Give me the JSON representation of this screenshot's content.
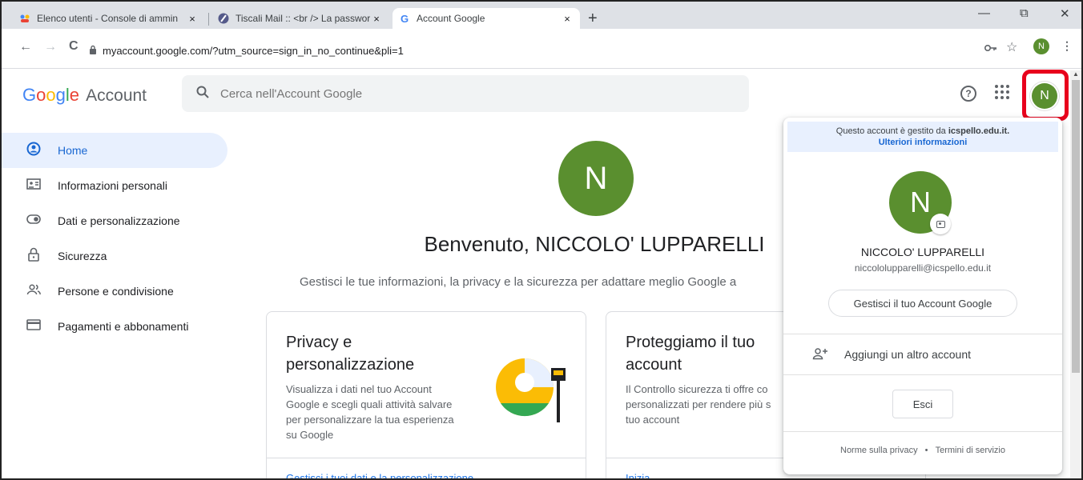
{
  "browser": {
    "tabs": [
      {
        "title": "Elenco utenti - Console di ammin",
        "icon": "admin-console-icon"
      },
      {
        "title": "Tiscali Mail :: <br /> La password",
        "icon": "tiscali-icon"
      },
      {
        "title": "Account Google",
        "icon": "google-g-icon"
      }
    ],
    "close_glyph": "×",
    "new_tab_glyph": "+",
    "url": "myaccount.google.com/?utm_source=sign_in_no_continue&pli=1",
    "profile_initial": "N"
  },
  "header": {
    "logo_letters": [
      "G",
      "o",
      "o",
      "g",
      "l",
      "e"
    ],
    "logo_suffix": "Account",
    "search_placeholder": "Cerca nell'Account Google",
    "help_glyph": "?",
    "avatar_initial": "N"
  },
  "sidebar": {
    "items": [
      {
        "label": "Home",
        "icon": "home-icon",
        "active": true
      },
      {
        "label": "Informazioni personali",
        "icon": "id-card-icon",
        "active": false
      },
      {
        "label": "Dati e personalizzazione",
        "icon": "toggle-icon",
        "active": false
      },
      {
        "label": "Sicurezza",
        "icon": "lock-icon",
        "active": false
      },
      {
        "label": "Persone e condivisione",
        "icon": "people-icon",
        "active": false
      },
      {
        "label": "Pagamenti e abbonamenti",
        "icon": "credit-card-icon",
        "active": false
      }
    ]
  },
  "main": {
    "avatar_initial": "N",
    "welcome": "Benvenuto, NICCOLO' LUPPARELLI",
    "subtitle": "Gestisci le tue informazioni, la privacy e la sicurezza per adattare meglio Google a",
    "cards": [
      {
        "title_line1": "Privacy e",
        "title_line2": "personalizzazione",
        "body_lines": [
          "Visualizza i dati nel tuo Account",
          "Google e scegli quali attività salvare",
          "per personalizzare la tua esperienza",
          "su Google"
        ],
        "link": "Gestisci i tuoi dati e la personalizzazione"
      },
      {
        "title_line1": "Proteggiamo il tuo",
        "title_line2": "account",
        "body_lines": [
          "Il Controllo sicurezza ti offre co",
          "personalizzati per rendere più s",
          "tuo account"
        ],
        "link": "Inizia"
      }
    ]
  },
  "account_popup": {
    "banner_text": "Questo account è gestito da",
    "banner_domain": "icspello.edu.it.",
    "banner_link": "Ulteriori informazioni",
    "avatar_initial": "N",
    "name": "NICCOLO' LUPPARELLI",
    "email": "niccololupparelli@icspello.edu.it",
    "manage_button": "Gestisci il tuo Account Google",
    "add_account": "Aggiungi un altro account",
    "sign_out": "Esci",
    "privacy_link": "Norme sulla privacy",
    "footer_sep": "•",
    "terms_link": "Termini di servizio"
  },
  "colors": {
    "avatar_green": "#5a8f2f",
    "highlight_red": "#e8001c",
    "active_blue": "#1967d2",
    "link_blue": "#1a73e8"
  }
}
